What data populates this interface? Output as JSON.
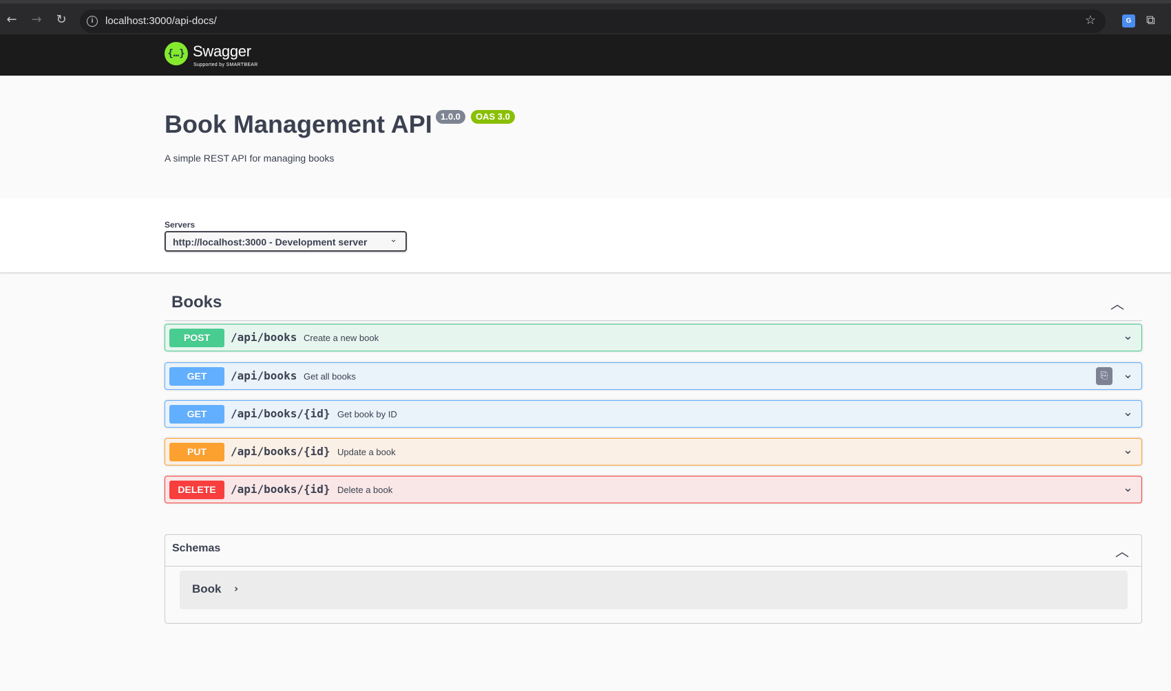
{
  "browser": {
    "url": "localhost:3000/api-docs/",
    "back_icon": "←",
    "forward_icon": "→",
    "reload_icon": "↻",
    "info_icon": "i",
    "star_icon": "☆",
    "translate_icon": "G",
    "extensions_icon": "⧉"
  },
  "topbar": {
    "logo_symbol": "{…}",
    "logo_text": "Swagger",
    "logo_sub": "Supported by SMARTBEAR"
  },
  "info": {
    "title": "Book Management API",
    "version": "1.0.0",
    "oas": "OAS 3.0",
    "description": "A simple REST API for managing books"
  },
  "servers": {
    "label": "Servers",
    "selected": "http://localhost:3000 - Development server",
    "chevron": "⌄"
  },
  "tag": {
    "name": "Books",
    "arrow": "︿"
  },
  "operations": [
    {
      "method": "POST",
      "path": "/api/books",
      "summary": "Create a new book",
      "chevron": "⌄"
    },
    {
      "method": "GET",
      "path": "/api/books",
      "summary": "Get all books",
      "chevron": "⌄",
      "copy_icon": "⎘"
    },
    {
      "method": "GET",
      "path": "/api/books/{id}",
      "summary": "Get book by ID",
      "chevron": "⌄"
    },
    {
      "method": "PUT",
      "path": "/api/books/{id}",
      "summary": "Update a book",
      "chevron": "⌄"
    },
    {
      "method": "DELETE",
      "path": "/api/books/{id}",
      "summary": "Delete a book",
      "chevron": "⌄"
    }
  ],
  "schemas": {
    "title": "Schemas",
    "arrow": "︿",
    "models": [
      {
        "name": "Book",
        "arrow": "›"
      }
    ]
  },
  "colors": {
    "post": "#49cc90",
    "get": "#61affe",
    "put": "#fca130",
    "delete": "#f93e3e",
    "swagger_green": "#85ea2d"
  }
}
